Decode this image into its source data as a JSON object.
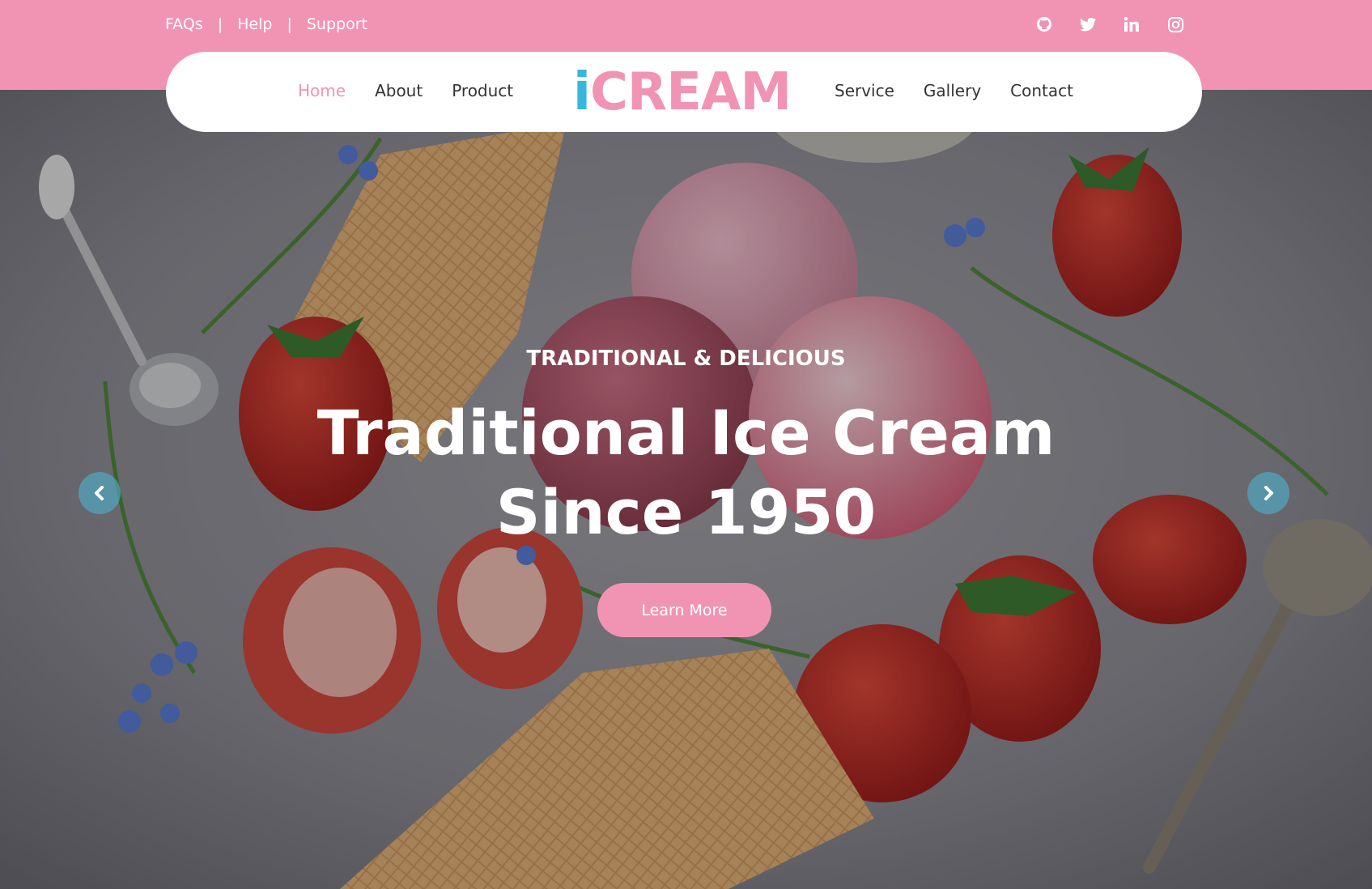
{
  "topbar": {
    "links": [
      "FAQs",
      "Help",
      "Support"
    ],
    "separator": "|",
    "socials": [
      "github-icon",
      "twitter-icon",
      "linkedin-icon",
      "instagram-icon"
    ]
  },
  "nav": {
    "left": [
      "Home",
      "About",
      "Product"
    ],
    "right": [
      "Service",
      "Gallery",
      "Contact"
    ],
    "active": "Home",
    "logo_first": "i",
    "logo_rest": "CREAM"
  },
  "hero": {
    "subtitle": "TRADITIONAL & DELICIOUS",
    "headline_line1": "Traditional Ice Cream",
    "headline_line2": "Since 1950",
    "cta": "Learn More",
    "prev_icon": "chevron-left-icon",
    "next_icon": "chevron-right-icon"
  },
  "colors": {
    "brand_pink": "#f194b3",
    "brand_blue": "#37b7dc"
  }
}
